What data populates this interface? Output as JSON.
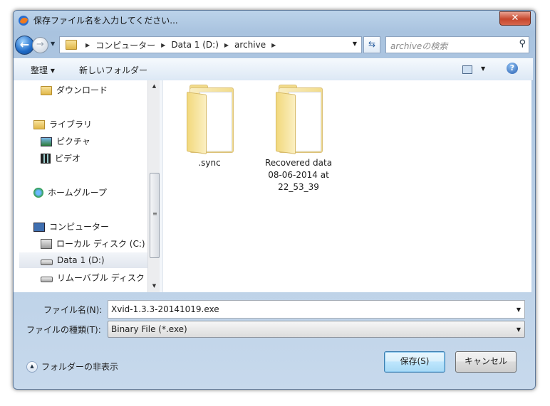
{
  "window": {
    "title": "保存ファイル名を入力してください...",
    "close_label": "✕"
  },
  "nav": {
    "breadcrumbs": [
      "コンピューター",
      "Data 1 (D:)",
      "archive"
    ],
    "search_placeholder": "archiveの検索"
  },
  "toolbar": {
    "organize": "整理 ▾",
    "new_folder": "新しいフォルダー"
  },
  "sidebar": {
    "items": [
      {
        "label": "ダウンロード",
        "icon": "download-folder-icon"
      },
      {
        "label": "ライブラリ",
        "icon": "library-icon"
      },
      {
        "label": "ピクチャ",
        "icon": "pictures-icon"
      },
      {
        "label": "ビデオ",
        "icon": "videos-icon"
      },
      {
        "label": "ホームグループ",
        "icon": "homegroup-icon"
      },
      {
        "label": "コンピューター",
        "icon": "computer-icon"
      },
      {
        "label": "ローカル ディスク (C:)",
        "icon": "local-disk-icon"
      },
      {
        "label": "Data 1 (D:)",
        "icon": "drive-icon",
        "selected": true
      },
      {
        "label": "リムーバブル ディスク (",
        "icon": "removable-drive-icon"
      }
    ]
  },
  "files": [
    {
      "name": ".sync"
    },
    {
      "name": "Recovered data 08-06-2014 at 22_53_39"
    }
  ],
  "form": {
    "filename_label": "ファイル名(N):",
    "filename_value": "Xvid-1.3.3-20141019.exe",
    "filetype_label": "ファイルの種類(T):",
    "filetype_value": "Binary File (*.exe)",
    "hide_folders": "フォルダーの非表示",
    "save_button": "保存(S)",
    "cancel_button": "キャンセル"
  }
}
